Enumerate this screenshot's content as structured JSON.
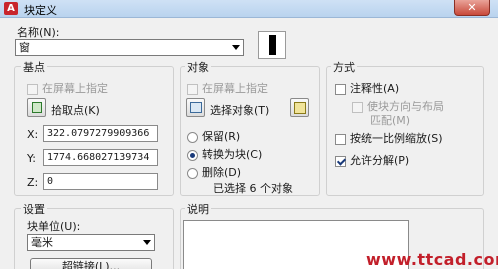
{
  "window": {
    "title": "块定义",
    "close_label": "✕"
  },
  "name": {
    "label": "名称(N):",
    "value": "窗"
  },
  "base_point": {
    "title": "基点",
    "specify_on_screen": "在屏幕上指定",
    "pick_point": "拾取点(K)",
    "x_label": "X:",
    "x_value": "322.0797279909366",
    "y_label": "Y:",
    "y_value": "1774.668027139734",
    "z_label": "Z:",
    "z_value": "0"
  },
  "objects": {
    "title": "对象",
    "specify_on_screen": "在屏幕上指定",
    "select_objects": "选择对象(T)",
    "retain": "保留(R)",
    "convert_to_block": "转换为块(C)",
    "delete": "删除(D)",
    "selected_count": "已选择 6 个对象"
  },
  "behavior": {
    "title": "方式",
    "annotative": "注释性(A)",
    "match_orientation_line1": "使块方向与布局",
    "match_orientation_line2": "匹配(M)",
    "scale_uniformly": "按统一比例缩放(S)",
    "allow_exploding": "允许分解(P)"
  },
  "settings": {
    "title": "设置",
    "block_unit_label": "块单位(U):",
    "block_unit_value": "毫米",
    "hyperlink_button": "超链接(L)..."
  },
  "description": {
    "title": "说明"
  },
  "watermark": "www.ttcad.com"
}
